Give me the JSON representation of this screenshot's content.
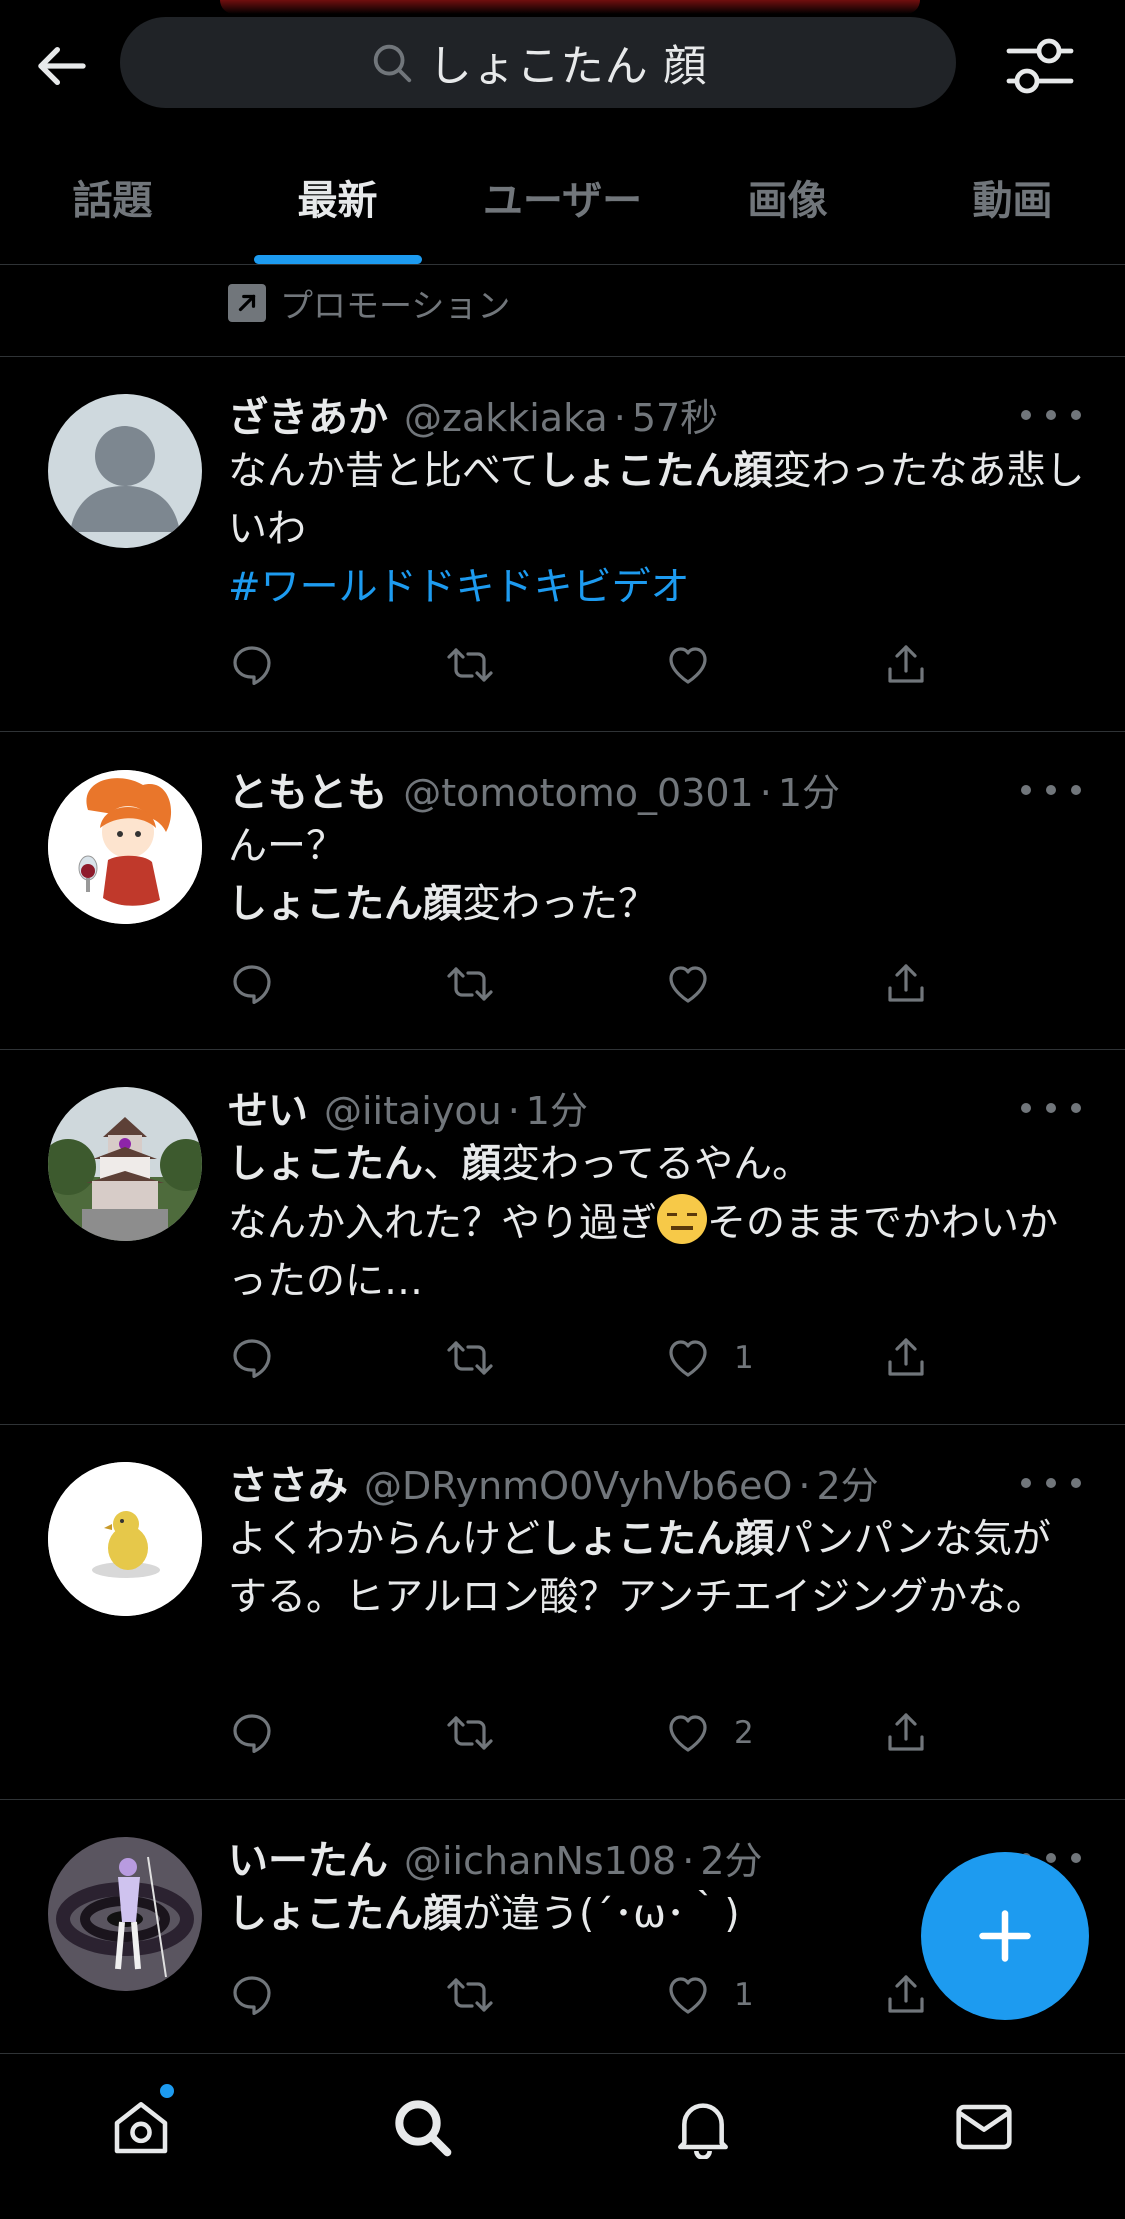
{
  "search": {
    "query": "しょこたん 顔"
  },
  "tabs": [
    {
      "label": "話題",
      "active": false
    },
    {
      "label": "最新",
      "active": true
    },
    {
      "label": "ユーザー",
      "active": false
    },
    {
      "label": "画像",
      "active": false
    },
    {
      "label": "動画",
      "active": false
    }
  ],
  "promo": {
    "label": "プロモーション"
  },
  "tweets": [
    {
      "name": "ざきあか",
      "handle": "@zakkiaka",
      "time": "57秒",
      "body": [
        "なんか昔と比べて",
        "しょこたん顔",
        "変わったなあ悲しいわ"
      ],
      "hashtag": "#ワールドドキドキビデオ",
      "likes": ""
    },
    {
      "name": "ともとも",
      "handle": "@tomotomo_0301",
      "time": "1分",
      "line1": "んー？",
      "body": [
        "しょこたん顔",
        "変わった？"
      ],
      "likes": ""
    },
    {
      "name": "せい",
      "handle": "@iitaiyou",
      "time": "1分",
      "body": [
        "しょこたん",
        "、",
        "顔",
        "変わってるやん。",
        "なんか入れた？やり過ぎ",
        "そのままでかわいかったのに…"
      ],
      "likes": "1"
    },
    {
      "name": "ささみ",
      "handle": "@DRynmO0VyhVb6eO",
      "time": "2分",
      "body": [
        "よくわからんけど",
        "しょこたん顔",
        "パンパンな気がする。ヒアルロン酸？アンチエイジングかな。"
      ],
      "likes": "2"
    },
    {
      "name": "いーたん",
      "handle": "@iichanNs108",
      "time": "2分",
      "body": [
        "しょこたん顔",
        "が違う(´･ω･｀)"
      ],
      "likes": "1"
    }
  ],
  "colors": {
    "accent": "#1d9bf0",
    "background": "#000000",
    "muted": "#71767b",
    "text": "#e7e9ea"
  },
  "icons": {
    "back": "arrow-left-icon",
    "search": "search-icon",
    "filter": "sliders-icon",
    "reply": "reply-icon",
    "retweet": "retweet-icon",
    "like": "heart-icon",
    "share": "share-icon",
    "compose": "plus-icon",
    "home": "home-icon",
    "explore": "search-icon",
    "notifications": "bell-icon",
    "messages": "envelope-icon"
  }
}
